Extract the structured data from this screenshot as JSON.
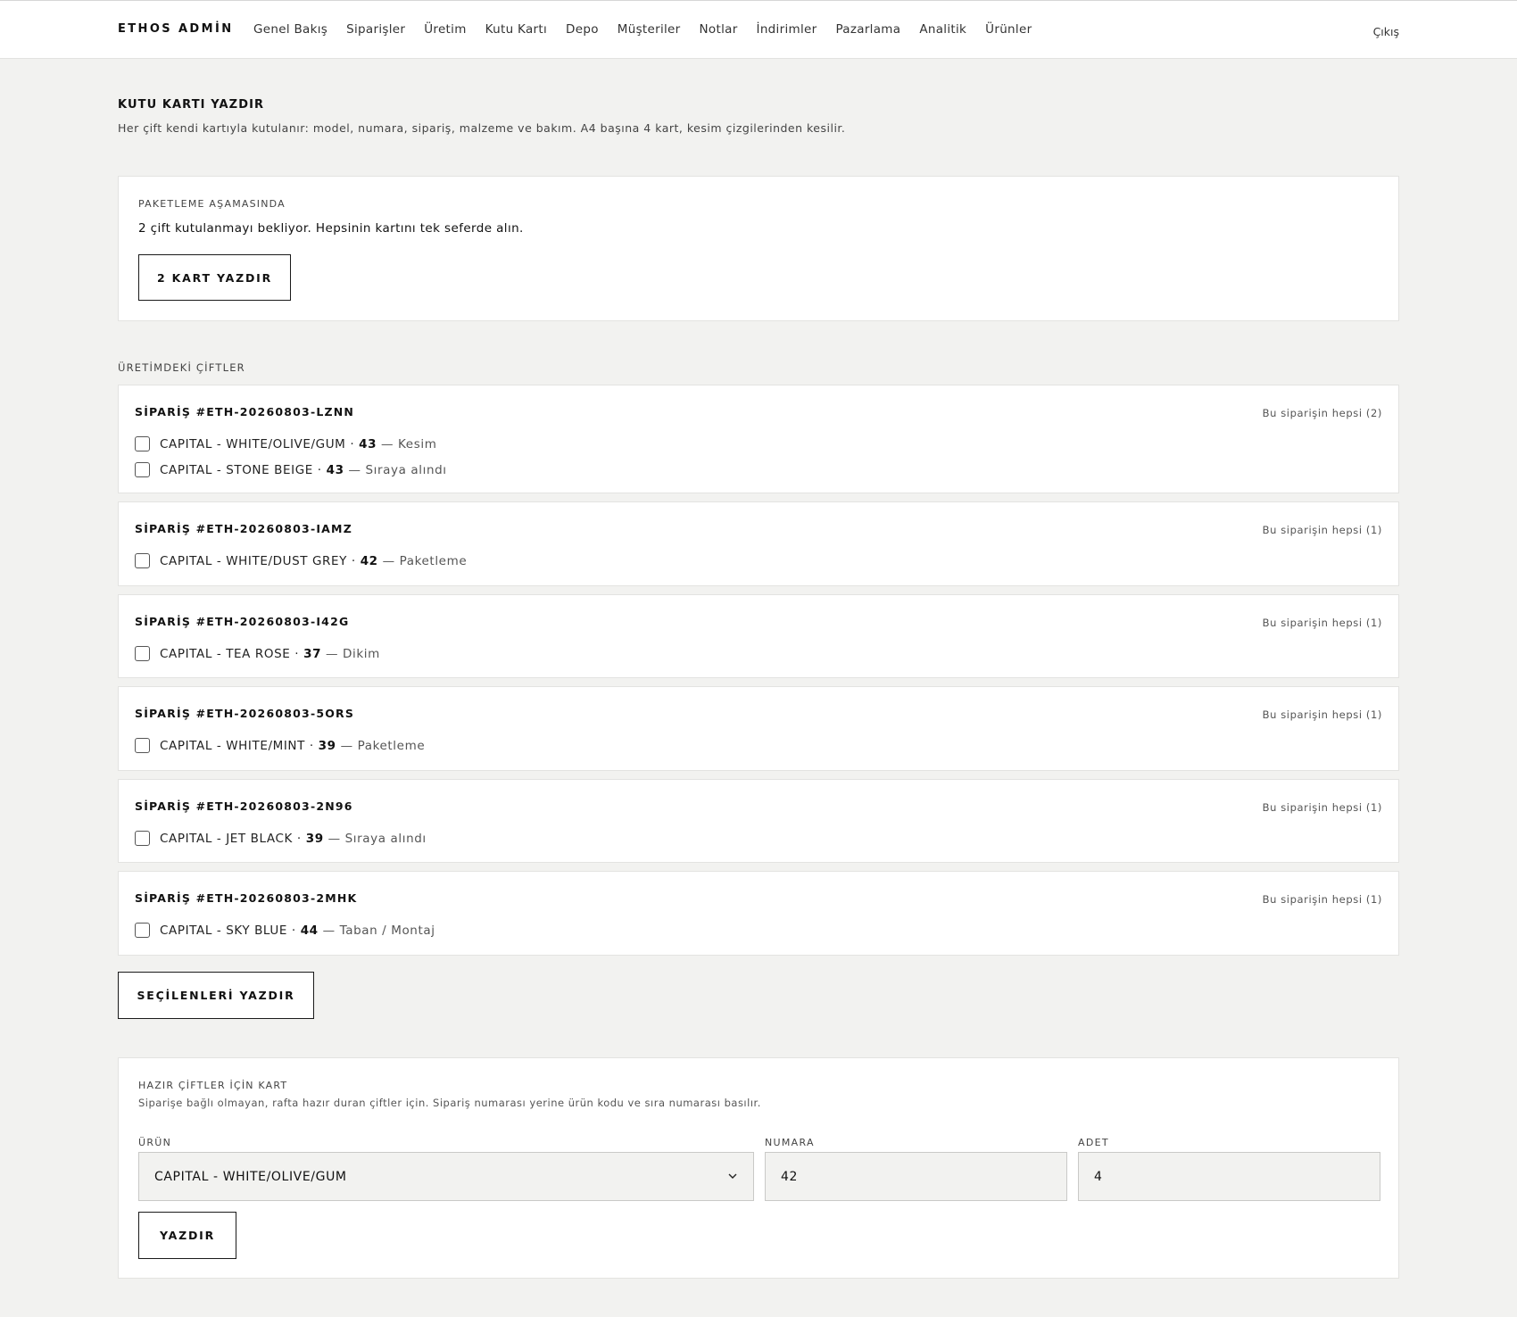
{
  "header": {
    "brand": "ETHOS ADMİN",
    "nav": [
      "Genel Bakış",
      "Siparişler",
      "Üretim",
      "Kutu Kartı",
      "Depo",
      "Müşteriler",
      "Notlar",
      "İndirimler",
      "Pazarlama",
      "Analitik",
      "Ürünler"
    ],
    "logout": "Çıkış"
  },
  "page": {
    "title": "KUTU KARTI YAZDIR",
    "subtitle": "Her çift kendi kartıyla kutulanır: model, numara, sipariş, malzeme ve bakım. A4 başına 4 kart, kesim çizgilerinden kesilir."
  },
  "packaging": {
    "eyebrow": "PAKETLEME AŞAMASINDA",
    "message": "2 çift kutulanmayı bekliyor. Hepsinin kartını tek seferde alın.",
    "button": "2 KART YAZDIR"
  },
  "production": {
    "label": "ÜRETİMDEKİ ÇİFTLER",
    "orders": [
      {
        "title": "SİPARİŞ #ETH-20260803-LZNN",
        "all": "Bu siparişin hepsi (2)",
        "items": [
          {
            "name": "CAPITAL - WHITE/OLIVE/GUM ·",
            "size": "43",
            "stage": "— Kesim"
          },
          {
            "name": "CAPITAL - STONE BEIGE ·",
            "size": "43",
            "stage": "— Sıraya alındı"
          }
        ]
      },
      {
        "title": "SİPARİŞ #ETH-20260803-IAMZ",
        "all": "Bu siparişin hepsi (1)",
        "items": [
          {
            "name": "CAPITAL - WHITE/DUST GREY ·",
            "size": "42",
            "stage": "— Paketleme"
          }
        ]
      },
      {
        "title": "SİPARİŞ #ETH-20260803-I42G",
        "all": "Bu siparişin hepsi (1)",
        "items": [
          {
            "name": "CAPITAL - TEA ROSE ·",
            "size": "37",
            "stage": "— Dikim"
          }
        ]
      },
      {
        "title": "SİPARİŞ #ETH-20260803-5ORS",
        "all": "Bu siparişin hepsi (1)",
        "items": [
          {
            "name": "CAPITAL - WHITE/MINT ·",
            "size": "39",
            "stage": "— Paketleme"
          }
        ]
      },
      {
        "title": "SİPARİŞ #ETH-20260803-2N96",
        "all": "Bu siparişin hepsi (1)",
        "items": [
          {
            "name": "CAPITAL - JET BLACK ·",
            "size": "39",
            "stage": "— Sıraya alındı"
          }
        ]
      },
      {
        "title": "SİPARİŞ #ETH-20260803-2MHK",
        "all": "Bu siparişin hepsi (1)",
        "items": [
          {
            "name": "CAPITAL - SKY BLUE ·",
            "size": "44",
            "stage": "— Taban / Montaj"
          }
        ]
      }
    ],
    "print_selected": "SEÇİLENLERİ YAZDIR"
  },
  "ready": {
    "eyebrow": "HAZIR ÇİFTLER İÇİN KART",
    "subtitle": "Siparişe bağlı olmayan, rafta hazır duran çiftler için. Sipariş numarası yerine ürün kodu ve sıra numarası basılır.",
    "product_label": "ÜRÜN",
    "product_value": "CAPITAL - WHITE/OLIVE/GUM",
    "size_label": "NUMARA",
    "size_value": "42",
    "qty_label": "ADET",
    "qty_value": "4",
    "button": "YAZDIR"
  }
}
